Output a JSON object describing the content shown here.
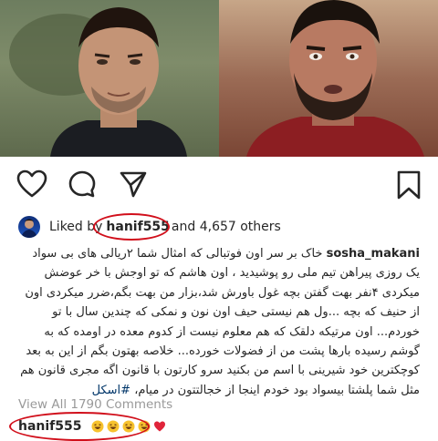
{
  "post": {
    "likes": {
      "prefix": "Liked by",
      "liker": "hanif555",
      "suffix": "and 4,657 others"
    },
    "caption": {
      "author": "sosha_makani",
      "text": "خاک بر سر اون فوتبالی که امثال شما ۲ریالی های بی سواد یک روزی پیراهن تیم ملی رو پوشیدید ، اون هاشم که تو اوجش با خر عوضش میکردی ۴نفر بهت گفتن بچه غول باورش شد،بزار من بهت بگم،ضرر میکردی اون از حنیف که بچه ...ول هم نیستی حیف اون نون و نمکی که چندین سال با تو خوردم... اون مرتیکه دلقک که هم معلوم نیست از کدوم معده در اومده که به گوشم رسیده بارها پشت من از فضولات خورده... خلاصه بهتون بگم از این به بعد کوچکترین خود شیرینی با اسم من بکنید سرو کارتون با قانون اگه مجری قانون هم مثل شما پلشتا بیسواد بود خودم اینجا از خجالتتون در میام،",
      "hashtag": "#اسکل"
    },
    "view_all_comments": "View All 1790 Comments",
    "top_comment": {
      "user": "hanif555",
      "emojis": [
        "laughing-emoji",
        "laughing-emoji",
        "laughing-emoji",
        "laughing-emoji",
        "heart-emoji"
      ]
    }
  },
  "colors": {
    "annotation_red": "#d10f1b",
    "muted_text": "#999999",
    "hashtag": "#003569"
  }
}
